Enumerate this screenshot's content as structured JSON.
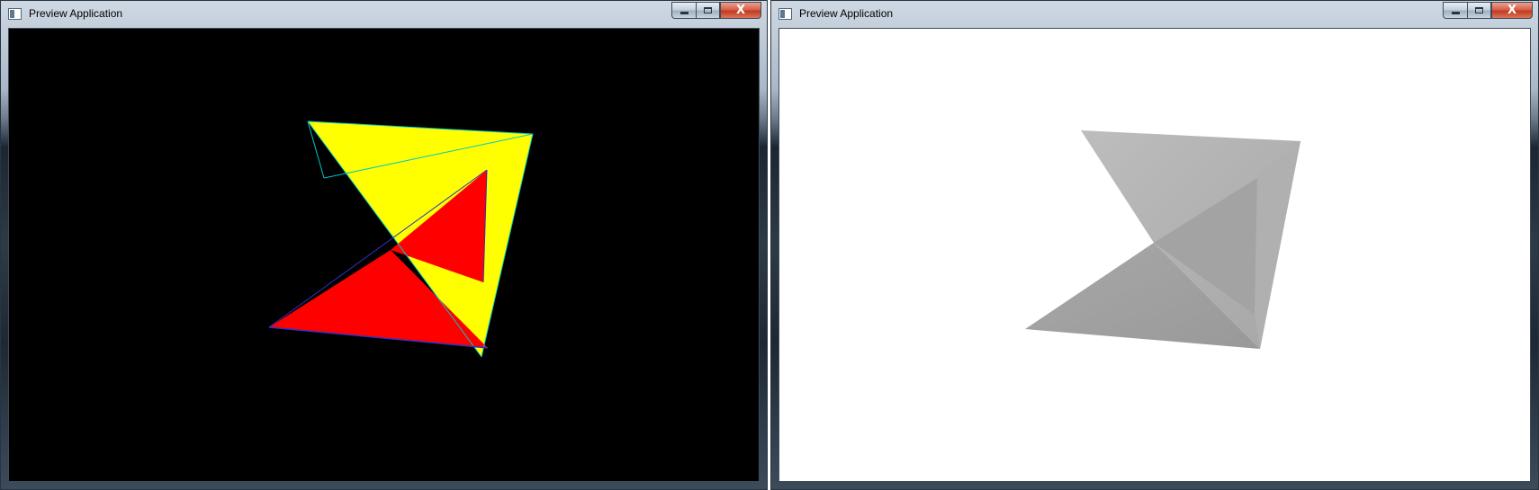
{
  "windows": [
    {
      "title": "Preview Application",
      "viewport_background": "#000000",
      "caption_buttons": [
        "minimize-icon",
        "maximize-icon",
        "close-icon"
      ],
      "shape_colors": {
        "front_face": "#ffff00",
        "back_face": "#ff0000",
        "edge_green": "#00c8c8",
        "edge_blue": "#3030c0"
      }
    },
    {
      "title": "Preview Application",
      "viewport_background": "#ffffff",
      "caption_buttons": [
        "minimize-icon",
        "maximize-icon",
        "close-icon"
      ],
      "shape_colors": {
        "light": "#b4b4b4",
        "mid": "#a2a2a2",
        "dark": "#939393"
      }
    }
  ],
  "close_glyph": "X"
}
